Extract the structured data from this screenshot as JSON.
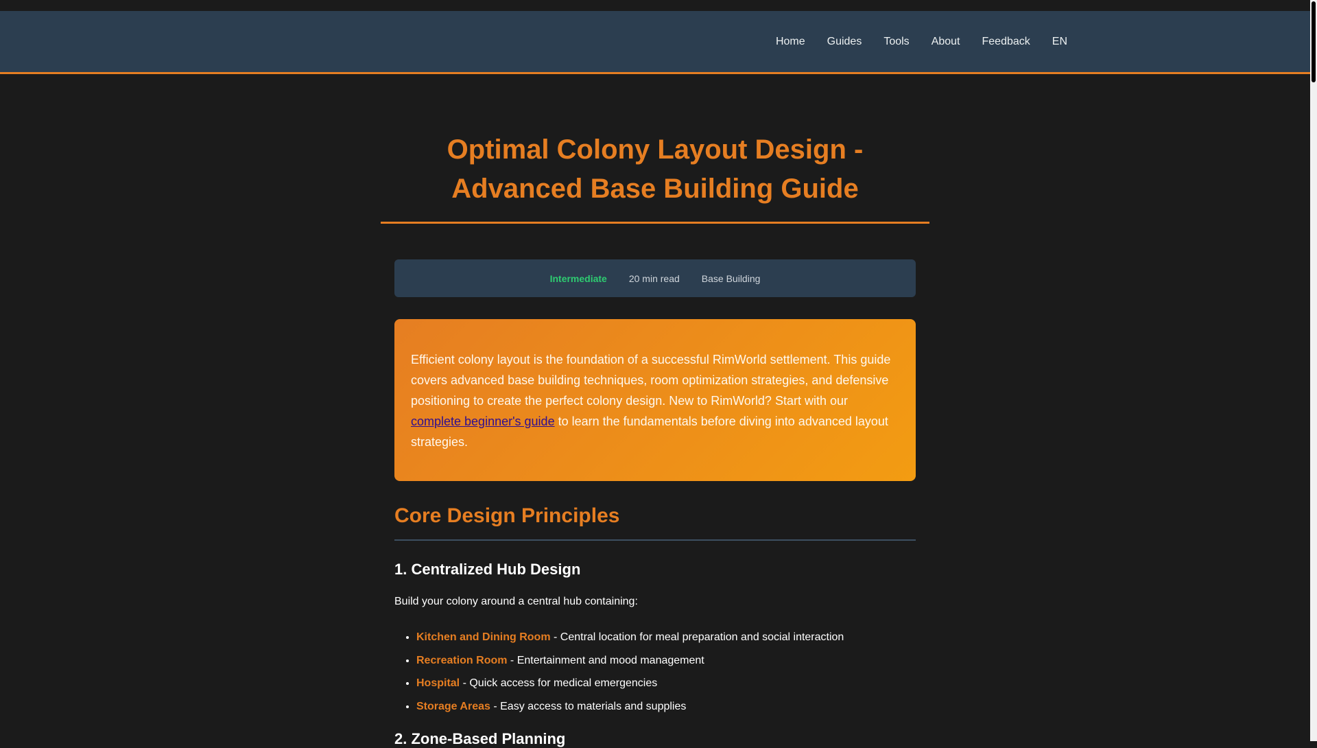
{
  "nav": {
    "links": [
      "Home",
      "Guides",
      "Tools",
      "About",
      "Feedback",
      "EN"
    ]
  },
  "article": {
    "title": "Optimal Colony Layout Design - Advanced Base Building Guide",
    "meta": {
      "difficulty": "Intermediate",
      "read_time": "20 min read",
      "category": "Base Building"
    },
    "intro": {
      "text_before_link": "Efficient colony layout is the foundation of a successful RimWorld settlement. This guide covers advanced base building techniques, room optimization strategies, and defensive positioning to create the perfect colony design. New to RimWorld? Start with our ",
      "link_text": "complete beginner's guide",
      "text_after_link": " to learn the fundamentals before diving into advanced layout strategies."
    },
    "section": {
      "title": "Core Design Principles",
      "subsection_1": {
        "title": "1. Centralized Hub Design",
        "paragraph": "Build your colony around a central hub containing:",
        "items": [
          {
            "name": "Kitchen and Dining Room",
            "desc": " - Central location for meal preparation and social interaction"
          },
          {
            "name": "Recreation Room",
            "desc": " - Entertainment and mood management"
          },
          {
            "name": "Hospital",
            "desc": " - Quick access for medical emergencies"
          },
          {
            "name": "Storage Areas",
            "desc": " - Easy access to materials and supplies"
          }
        ]
      },
      "subsection_2": {
        "title": "2. Zone-Based Planning"
      }
    }
  },
  "colors": {
    "accent": "#e67e22",
    "nav_bg": "#2c3e50",
    "page_bg": "#1b1b1b",
    "difficulty": "#2ecc71"
  }
}
